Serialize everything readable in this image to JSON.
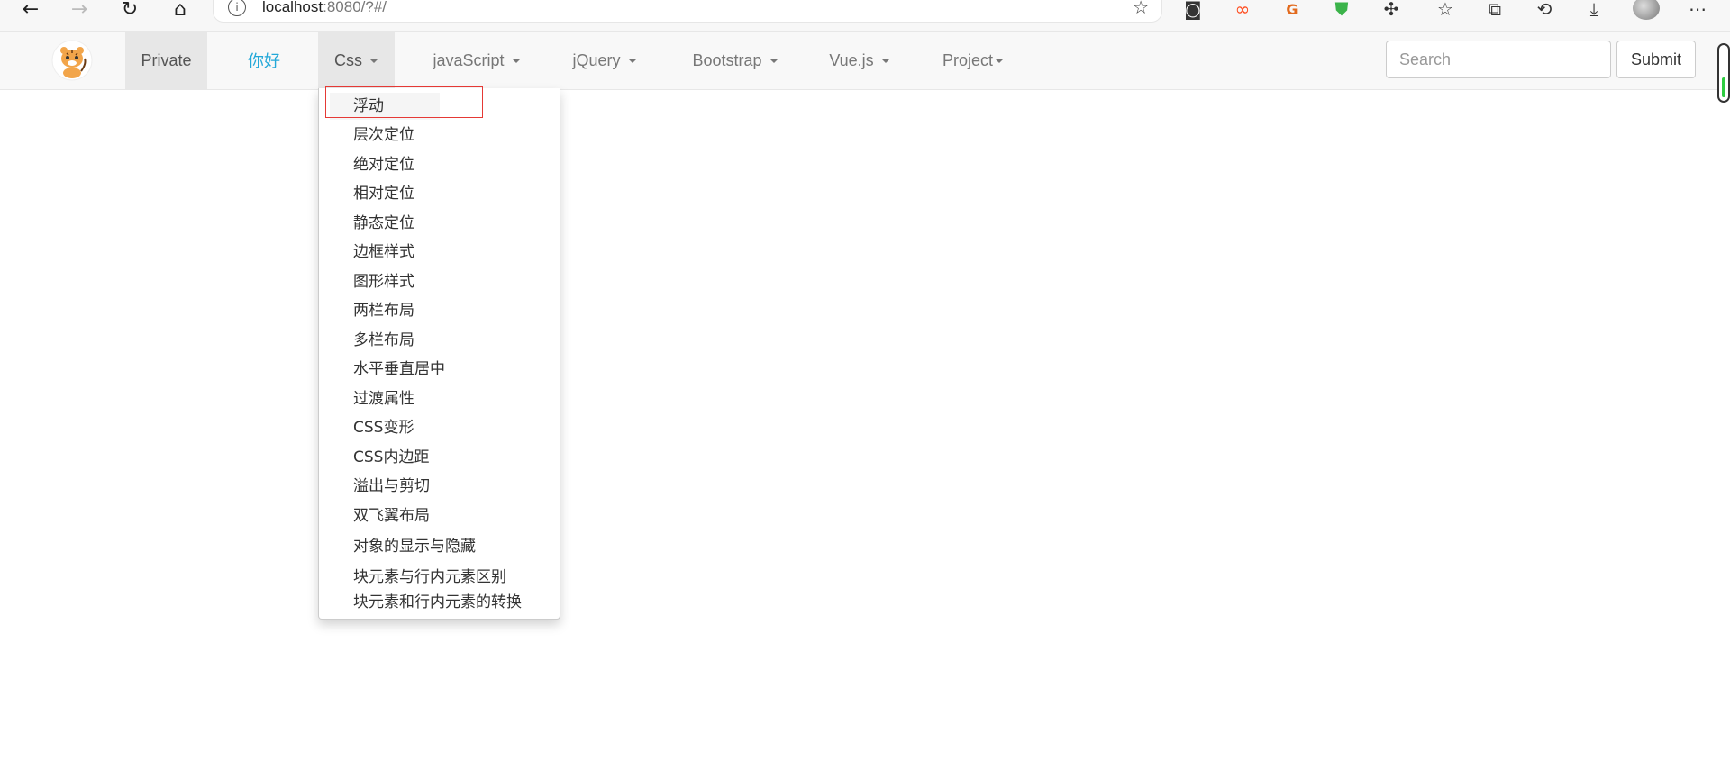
{
  "browser": {
    "url_host": "localhost",
    "url_rest": ":8080/?#/"
  },
  "navbar": {
    "items": [
      {
        "label": "Private"
      },
      {
        "label": "你好"
      },
      {
        "label": "Css"
      },
      {
        "label": "javaScript"
      },
      {
        "label": "jQuery"
      },
      {
        "label": "Bootstrap"
      },
      {
        "label": "Vue.js"
      },
      {
        "label": "Project"
      }
    ],
    "search_placeholder": "Search",
    "submit_label": "Submit"
  },
  "dropdown": {
    "items": [
      "浮动",
      "层次定位",
      "绝对定位",
      "相对定位",
      "静态定位",
      "边框样式",
      "图形样式",
      "两栏布局",
      "多栏布局",
      "水平垂直居中",
      "过渡属性",
      "CSS变形",
      "CSS内边距",
      "溢出与剪切",
      "双飞翼布局",
      "对象的显示与隐藏",
      "块元素与行内元素区别",
      "块元素和行内元素的转换"
    ]
  },
  "colors": {
    "accent_link": "#23a8d8",
    "highlight_box": "#e53935"
  }
}
